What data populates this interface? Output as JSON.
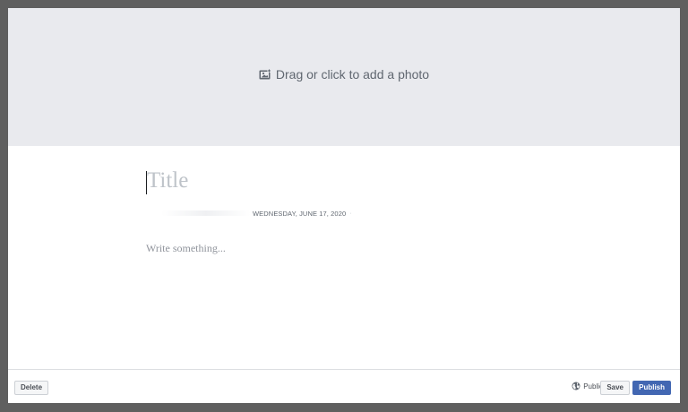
{
  "photo": {
    "prompt": "Drag or click to add a photo",
    "icon": "photo-icon"
  },
  "editor": {
    "title_placeholder": "Title",
    "date": "WEDNESDAY, JUNE 17, 2020",
    "meta_separator": "·",
    "body_placeholder": "Write something..."
  },
  "footer": {
    "delete_label": "Delete",
    "privacy_label": "Public",
    "privacy_icon": "globe-icon",
    "save_label": "Save",
    "publish_label": "Publish"
  },
  "colors": {
    "accent": "#4267b2",
    "photo_bg": "#e9eaee",
    "placeholder": "#bec3c9"
  }
}
